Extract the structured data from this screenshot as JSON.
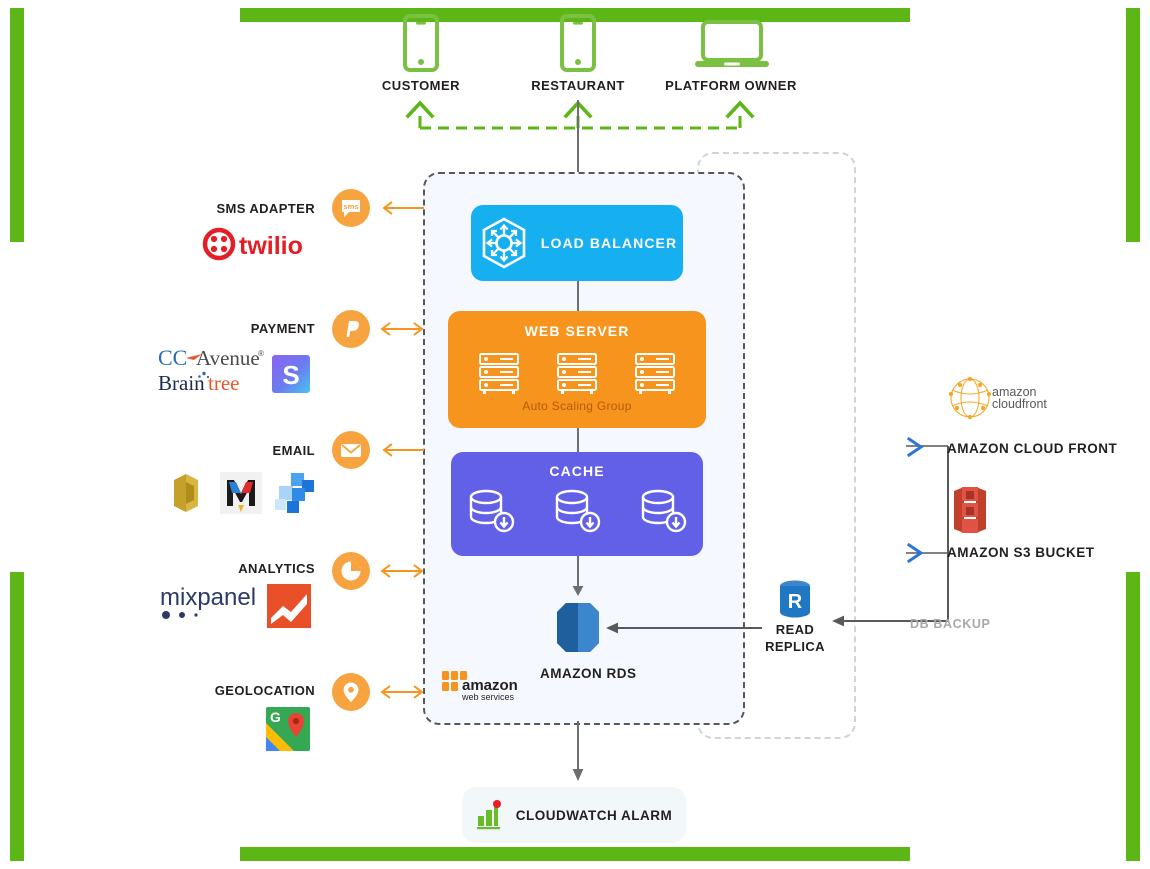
{
  "frame": {
    "accent_color": "#5cb615"
  },
  "clients": {
    "items": [
      {
        "label": "CUSTOMER",
        "icon": "mobile-phone-icon"
      },
      {
        "label": "RESTAURANT",
        "icon": "mobile-phone-icon"
      },
      {
        "label": "PLATFORM OWNER",
        "icon": "laptop-icon"
      }
    ]
  },
  "integrations": [
    {
      "label": "SMS ADAPTER",
      "icon": "sms-chat-icon",
      "arrow": "left",
      "vendors": [
        "twilio"
      ]
    },
    {
      "label": "PAYMENT",
      "icon": "paypal-icon",
      "arrow": "both",
      "vendors": [
        "CCAvenue",
        "Braintree",
        "Stripe"
      ]
    },
    {
      "label": "EMAIL",
      "icon": "envelope-icon",
      "arrow": "left",
      "vendors": [
        "Amazon SES",
        "Mandrill",
        "Mailchimp"
      ]
    },
    {
      "label": "ANALYTICS",
      "icon": "pie-chart-icon",
      "arrow": "both",
      "vendors": [
        "mixpanel",
        "Google Analytics"
      ]
    },
    {
      "label": "GEOLOCATION",
      "icon": "map-pin-icon",
      "arrow": "both",
      "vendors": [
        "Google Maps"
      ]
    }
  ],
  "stack": {
    "load_balancer": {
      "title": "LOAD BALANCER",
      "icon": "load-balancer-icon",
      "color": "#16b0f0"
    },
    "web_server": {
      "title": "WEB SERVER",
      "subtitle": "Auto Scaling Group",
      "icon": "server-rack-icon",
      "count": 3,
      "color": "#f7941e"
    },
    "cache": {
      "title": "CACHE",
      "icon": "database-download-icon",
      "count": 3,
      "color": "#6360e8"
    },
    "database": {
      "label": "AMAZON RDS",
      "icon": "amazon-rds-icon",
      "color": "#2e73b8"
    },
    "aws_logo": {
      "line1": "amazon",
      "line2": "web services"
    }
  },
  "right_services": [
    {
      "label": "AMAZON CLOUD FRONT",
      "icon": "amazon-cloudfront-icon",
      "logo_line1": "amazon",
      "logo_line2": "cloudfront"
    },
    {
      "label": "AMAZON S3 BUCKET",
      "icon": "amazon-s3-icon"
    }
  ],
  "read_replica": {
    "label_line1": "READ",
    "label_line2": "REPLICA",
    "icon": "rds-read-replica-icon",
    "badge": "R"
  },
  "db_backup": {
    "label": "DB BACKUP"
  },
  "monitoring": {
    "label": "CLOUDWATCH ALARM",
    "icon": "cloudwatch-alarm-icon"
  }
}
